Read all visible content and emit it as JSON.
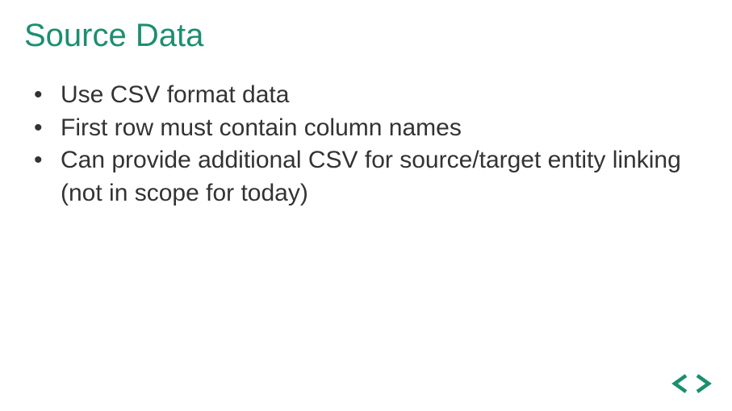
{
  "slide": {
    "title": "Source Data",
    "bullets": [
      "Use CSV format data",
      "First row must contain column names",
      "Can provide additional CSV for source/target entity linking (not in scope for today)"
    ]
  }
}
